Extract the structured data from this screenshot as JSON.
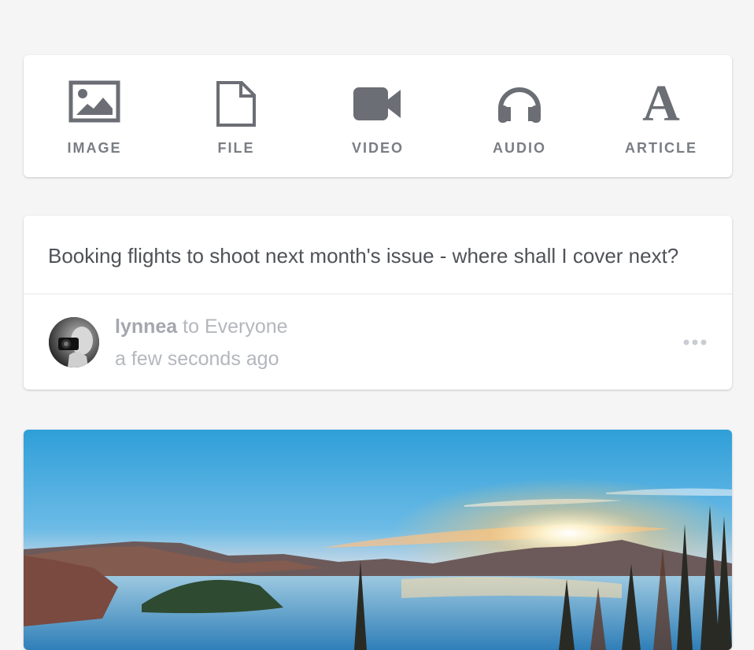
{
  "composer": {
    "items": [
      {
        "label": "IMAGE",
        "icon": "image-icon"
      },
      {
        "label": "FILE",
        "icon": "file-icon"
      },
      {
        "label": "VIDEO",
        "icon": "video-icon"
      },
      {
        "label": "AUDIO",
        "icon": "audio-icon"
      },
      {
        "label": "ARTICLE",
        "icon": "article-icon",
        "glyph": "A"
      }
    ]
  },
  "post": {
    "text": "Booking flights to shoot next month's issue - where shall I cover next?",
    "author": "lynnea",
    "audience": "to Everyone",
    "time": "a few seconds ago"
  },
  "colors": {
    "background": "#f5f5f5",
    "icon": "#6b6e74",
    "label": "#7a7d83",
    "meta": "#b4b7bd"
  }
}
